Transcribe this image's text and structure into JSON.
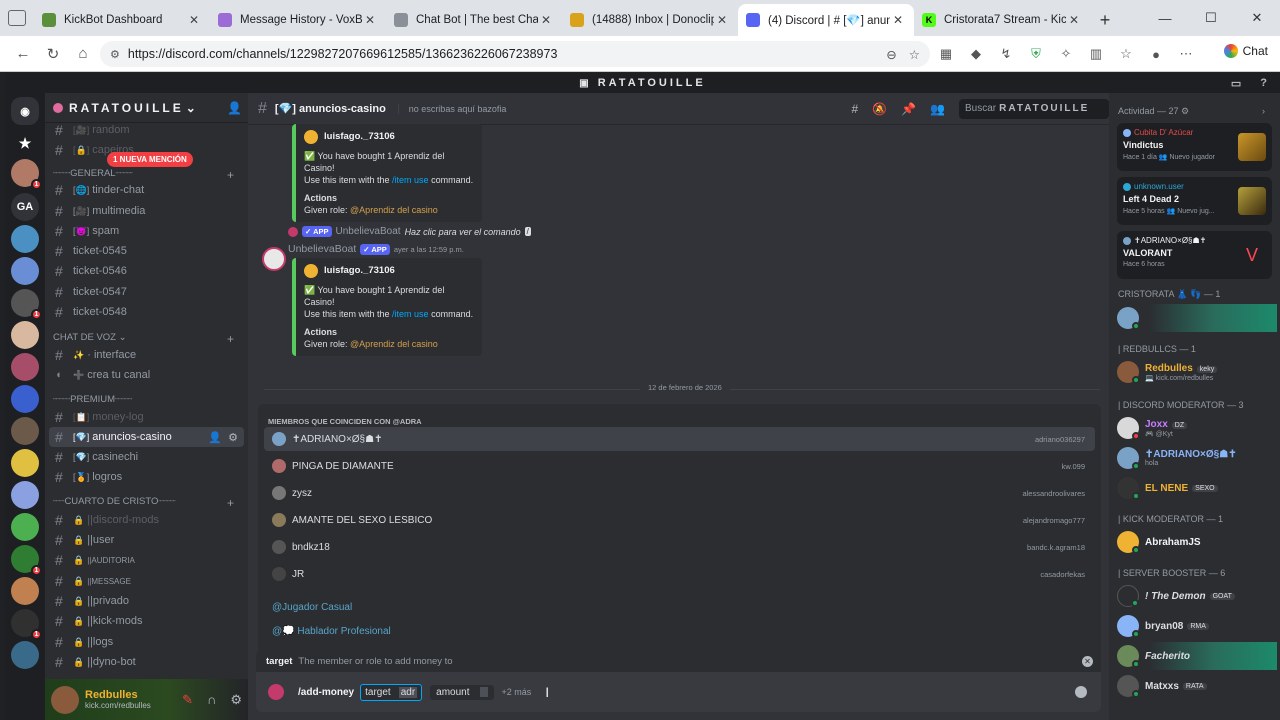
{
  "browser": {
    "tabs": [
      {
        "title": "KickBot Dashboard",
        "color": "#5a8f3c",
        "active": false
      },
      {
        "title": "Message History - VoxBot",
        "color": "#9b6bd6",
        "active": false
      },
      {
        "title": "Chat Bot | The best ChatBot",
        "color": "#8a8f98",
        "active": false
      },
      {
        "title": "(14888) Inbox | Donoclip",
        "color": "#d9a21b",
        "active": false
      },
      {
        "title": "(4) Discord | # [💎] anunc",
        "color": "#5865f2",
        "active": true
      },
      {
        "title": "Cristorata7 Stream - Kick D",
        "color": "#53fc18",
        "active": false
      }
    ],
    "url": "https://discord.com/channels/1229827207669612585/1366236226067238973",
    "chat_label": "Chat"
  },
  "discord": {
    "server_title": "RATATOUILLE",
    "rail": [
      "GA"
    ],
    "sidebar": {
      "server_name": "RATATOUILLE",
      "new_mention": "1 NUEVA MENCIÓN",
      "channels_top": [
        {
          "emoji": "[🎥]",
          "name": "random"
        },
        {
          "emoji": "[🔒]",
          "name": "capeiros"
        }
      ],
      "cat_general": "┈┈┈GENERAL┈┈┈",
      "general": [
        {
          "emoji": "[🌐]",
          "name": "tinder-chat"
        },
        {
          "emoji": "[🎥]",
          "name": "multimedia"
        },
        {
          "emoji": "[👿]",
          "name": "spam"
        },
        {
          "emoji": "",
          "name": "ticket-0545"
        },
        {
          "emoji": "",
          "name": "ticket-0546"
        },
        {
          "emoji": "",
          "name": "ticket-0547"
        },
        {
          "emoji": "",
          "name": "ticket-0548"
        }
      ],
      "cat_voice": "CHAT DE VOZ",
      "voice": [
        {
          "emoji": "✨",
          "name": "· interface"
        },
        {
          "emoji": "➕",
          "name": "crea tu canal"
        }
      ],
      "cat_premium": "┈┈┈PREMIUM┈┈┈",
      "premium": [
        {
          "emoji": "[📋]",
          "name": "money-log"
        },
        {
          "emoji": "[💎]",
          "name": "anuncios-casino"
        },
        {
          "emoji": "[💎]",
          "name": "casinechi"
        },
        {
          "emoji": "[🏅]",
          "name": "logros"
        }
      ],
      "cat_cristo": "┈┈CUARTO DE CRISTO┈┈┈",
      "cristo": [
        {
          "emoji": "🔒",
          "name": "||discord-mods"
        },
        {
          "emoji": "🔒",
          "name": "||user"
        },
        {
          "emoji": "🔒",
          "name": "||AUDITORIA"
        },
        {
          "emoji": "🔒",
          "name": "||MESSAGE"
        },
        {
          "emoji": "🔒",
          "name": "||privado"
        },
        {
          "emoji": "🔒",
          "name": "||kick-mods"
        },
        {
          "emoji": "🔒",
          "name": "||logs"
        },
        {
          "emoji": "🔒",
          "name": "||dyno-bot"
        }
      ],
      "user": {
        "name": "Redbulles",
        "status": "kick.com/redbulles"
      }
    },
    "channel": {
      "name": "[💎] anuncios-casino",
      "topic": "no escribas aquí bazofia",
      "search_placeholder": "Buscar",
      "search_server": "RATATOUILLE"
    },
    "messages": {
      "embed1": {
        "author": "luisfago._73106",
        "line1": "✅ You have bought 1 Aprendiz del Casino!",
        "line2a": "Use this item with the",
        "cmd": "/item use",
        "line2b": "command.",
        "actions_title": "Actions",
        "given_label": "Given role:",
        "role": "@Aprendiz del casino"
      },
      "msg2": {
        "app_tag": "✓ APP",
        "ref_user": "UnbelievaBoat",
        "ref_text": "Haz clic para ver el comando",
        "author": "UnbelievaBoat",
        "time": "ayer a las 12:59 p.m."
      },
      "embed2": {
        "author": "luisfago._73106",
        "line1": "✅ You have bought 1 Aprendiz del Casino!",
        "line2a": "Use this item with the",
        "cmd": "/item use",
        "line2b": "command.",
        "actions_title": "Actions",
        "given_label": "Given role:",
        "role": "@Aprendiz del casino"
      },
      "date_divider": "12 de febrero de 2026"
    },
    "autocomplete": {
      "title": "MIEMBROS QUE COINCIDEN CON @ADRA",
      "members": [
        {
          "name": "✝ADRIANO×Ø§☗✝",
          "handle": "adriano036297",
          "color": "#7aa2c7"
        },
        {
          "name": "PINGA DE DIAMANTE",
          "handle": "kw.099",
          "color": "#b06a6a"
        },
        {
          "name": "zysz",
          "handle": "alessandroolivares",
          "color": "#777"
        },
        {
          "name": "AMANTE DEL SEXO LESBICO",
          "handle": "alejandromago777",
          "color": "#8a7a5a"
        },
        {
          "name": "bndkz18",
          "handle": "bandc.k.agram18",
          "color": "#555"
        },
        {
          "name": "JR",
          "handle": "casadorfekas",
          "color": "#444"
        }
      ],
      "roles": [
        "@Jugador Casual",
        "@💭 Hablador Profesional"
      ]
    },
    "input": {
      "hint_name": "target",
      "hint_desc": "The member or role to add money to",
      "command": "/add-money",
      "opt1_name": "target",
      "opt1_value": "adr",
      "opt2_name": "amount",
      "more": "+2 más"
    },
    "activity": {
      "title": "Actividad — 27",
      "cards": [
        {
          "user": "Cubita D' Azúcar",
          "user_color": "#e34b4b",
          "game": "Vindictus",
          "status": "Hace 1 día  👥 Nuevo jugador"
        },
        {
          "user": "unknown.user",
          "user_color": "#2aa9d6",
          "game": "Left 4 Dead 2",
          "status": "Hace 5 horas  👥 Nuevo jug..."
        },
        {
          "user": "✝ADRIANO×Ø§☗✝",
          "user_color": "#f2f3f5",
          "game": "VALORANT",
          "status": "Hace 6 horas"
        }
      ],
      "groups": [
        {
          "label": "CRISTORATA 👗 👣 — 1"
        },
        {
          "label": "| REDBULLCS — 1"
        },
        {
          "label": "| DISCORD MODERATOR — 3"
        },
        {
          "label": "| KICK MODERATOR — 1"
        },
        {
          "label": "| SERVER BOOSTER — 6"
        }
      ],
      "members": [
        {
          "name": "Redbulles",
          "sub": "💻 kick.com/redbulles",
          "tag": "keky",
          "color": "#f0b232"
        },
        {
          "name": "Joxx",
          "sub": "🎮 @Kyt",
          "tag": "DZ",
          "color": "#c77dff"
        },
        {
          "name": "✝ADRIANO×Ø§☗✝",
          "sub": "hola",
          "tag": "",
          "color": "#8ab4f8"
        },
        {
          "name": "EL NENE",
          "sub": "",
          "tag": "SEXO",
          "color": "#f0b232"
        },
        {
          "name": "AbrahamJS",
          "sub": "",
          "tag": "",
          "color": "#f2f3f5"
        },
        {
          "name": "! The Demon",
          "sub": "",
          "tag": "GOAT",
          "color": "#f2f3f5"
        },
        {
          "name": "bryan08",
          "sub": "",
          "tag": "RMA",
          "color": "#f2f3f5"
        },
        {
          "name": "Facherito",
          "sub": "",
          "tag": "",
          "color": "#f2f3f5"
        },
        {
          "name": "Matxxs",
          "sub": "",
          "tag": "RATA",
          "color": "#f2f3f5"
        }
      ]
    }
  }
}
